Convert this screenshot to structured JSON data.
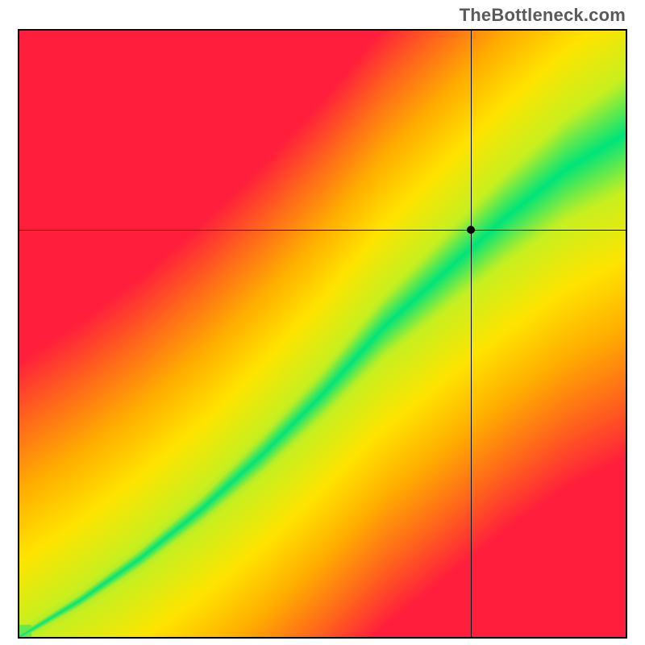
{
  "watermark": "TheBottleneck.com",
  "chart_data": {
    "type": "heatmap",
    "title": "",
    "xlabel": "",
    "ylabel": "",
    "xlim": [
      0,
      1
    ],
    "ylim": [
      0,
      1
    ],
    "optimal_curve": {
      "description": "Green optimal band along a slightly super-linear diagonal; band widens toward the upper-right.",
      "x": [
        0.0,
        0.1,
        0.2,
        0.3,
        0.4,
        0.5,
        0.6,
        0.7,
        0.8,
        0.9,
        1.0
      ],
      "y": [
        0.0,
        0.06,
        0.13,
        0.21,
        0.3,
        0.4,
        0.51,
        0.6,
        0.69,
        0.77,
        0.83
      ],
      "band_halfwidth": [
        0.005,
        0.01,
        0.015,
        0.02,
        0.028,
        0.035,
        0.045,
        0.055,
        0.065,
        0.075,
        0.085
      ]
    },
    "colormap": {
      "stops": [
        {
          "t": 0.0,
          "color": "#00e47a"
        },
        {
          "t": 0.2,
          "color": "#c9ef1f"
        },
        {
          "t": 0.4,
          "color": "#ffe400"
        },
        {
          "t": 0.6,
          "color": "#ffb000"
        },
        {
          "t": 0.8,
          "color": "#ff6a1a"
        },
        {
          "t": 1.0,
          "color": "#ff1e3c"
        }
      ]
    },
    "marker": {
      "x": 0.745,
      "y": 0.672
    },
    "grid": false,
    "legend": false
  }
}
